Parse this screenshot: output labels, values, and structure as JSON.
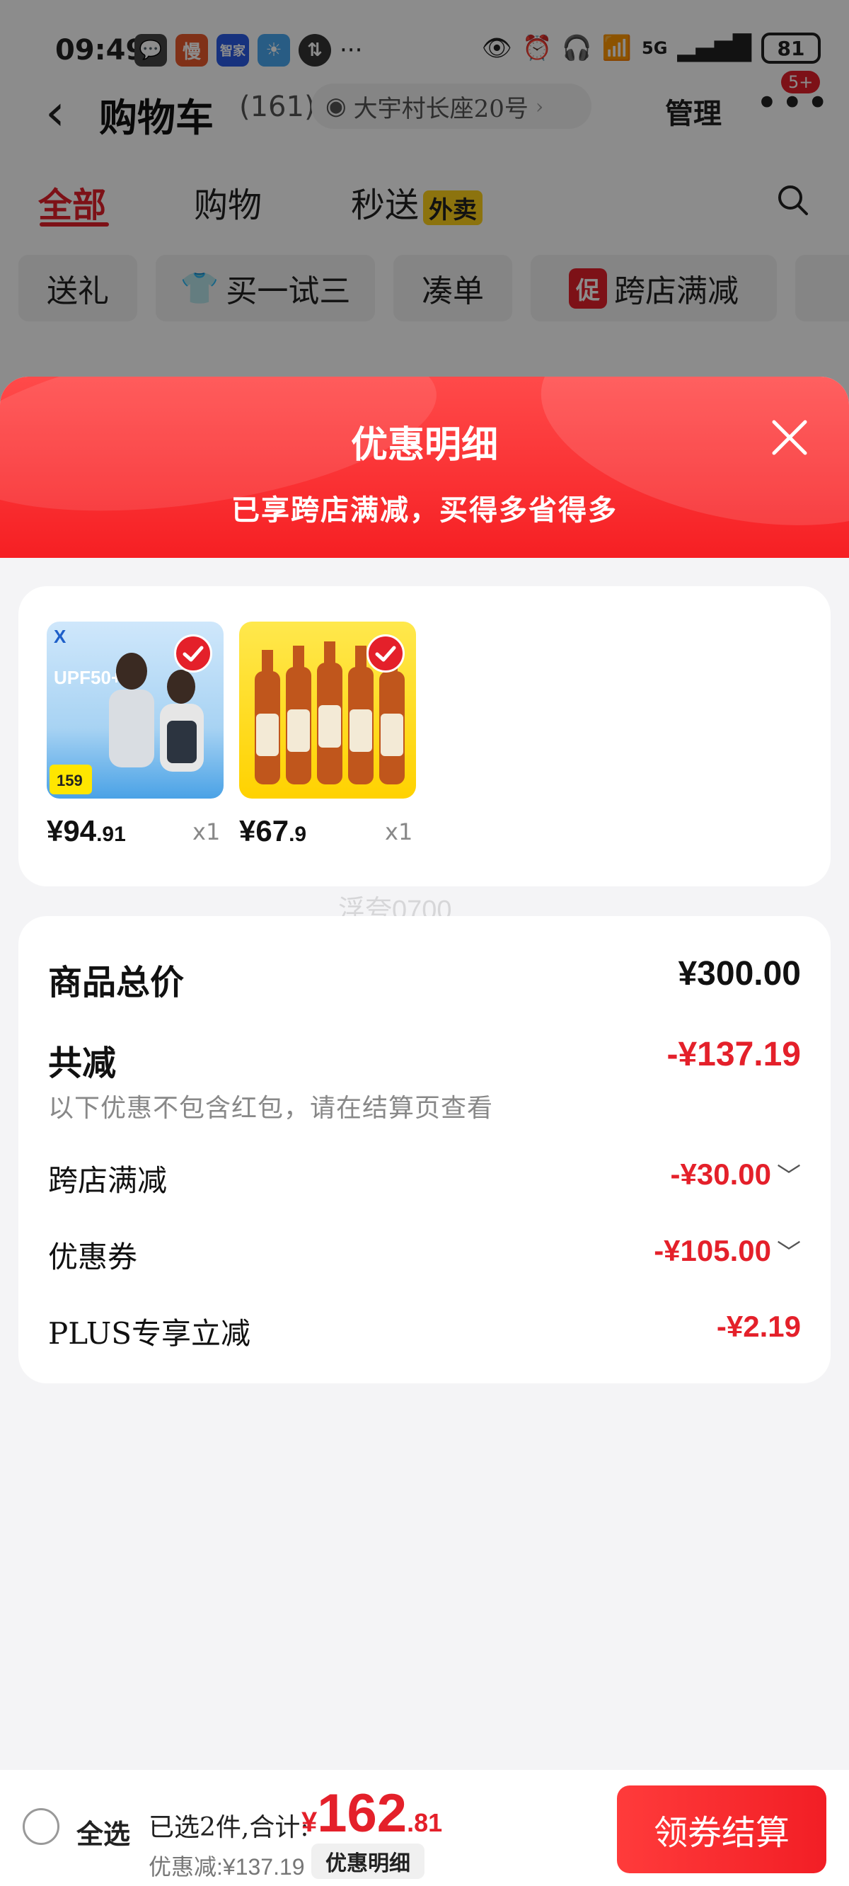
{
  "status_bar": {
    "time": "09:49",
    "apps": [
      {
        "name": "wechat-icon",
        "glyph": "💬",
        "color": "#444444"
      },
      {
        "name": "man-app-icon",
        "glyph": "慢",
        "color": "#e9592c"
      },
      {
        "name": "zhijia-app-icon",
        "glyph": "智家",
        "color": "#2b5ce6"
      },
      {
        "name": "weather-app-icon",
        "glyph": "☀",
        "color": "#4aa8f0"
      },
      {
        "name": "data-sync-icon",
        "glyph": "⇅",
        "color": "#333333"
      }
    ],
    "more_apps": "···",
    "network": "5G",
    "battery": "81"
  },
  "header": {
    "title": "购物车",
    "count": "(161)",
    "address": "大宇村长座20号",
    "manage": "管理",
    "more_badge": "5+"
  },
  "tabs": {
    "all": "全部",
    "shopping": "购物",
    "instant": "秒送",
    "waimai": "外卖"
  },
  "chips": {
    "gift": "送礼",
    "try": "买一试三",
    "bundle": "凑单",
    "promo_badge": "促",
    "cross_store": "跨店满减"
  },
  "sheet": {
    "title": "优惠明细",
    "subtitle": "已享跨店满减，买得多省得多"
  },
  "products": [
    {
      "price_int": "¥94",
      "price_dec": ".91",
      "qty": "x1",
      "image": "apparel-product-image"
    },
    {
      "price_int": "¥67",
      "price_dec": ".9",
      "qty": "x1",
      "image": "beer-product-image"
    }
  ],
  "product_a_art": {
    "badge": "UPF50+",
    "tag_price": "159"
  },
  "watermark": "浮夸0700",
  "summary": {
    "total_label": "商品总价",
    "total_value": "¥300.00",
    "reduction_label": "共减",
    "reduction_value": "-¥137.19",
    "note": "以下优惠不包含红包，请在结算页查看",
    "lines": [
      {
        "label": "跨店满减",
        "value": "-¥30.00",
        "chev": "﹀"
      },
      {
        "label": "优惠券",
        "value": "-¥105.00",
        "chev": "﹀"
      },
      {
        "label": "PLUS专享立减",
        "value": "-¥2.19",
        "chev": ""
      }
    ]
  },
  "bottom_bar": {
    "select_all": "全选",
    "selected_text": "已选2件,合计:",
    "total_currency": "¥",
    "total_int": "162",
    "total_dec": ".81",
    "discount": "优惠减:¥137.19",
    "detail_button": "优惠明细",
    "checkout_button": "领券结算"
  },
  "colors": {
    "accent": "#e4202a",
    "sheet_header": "#f61f23",
    "waimai_badge": "#ffd21a"
  }
}
